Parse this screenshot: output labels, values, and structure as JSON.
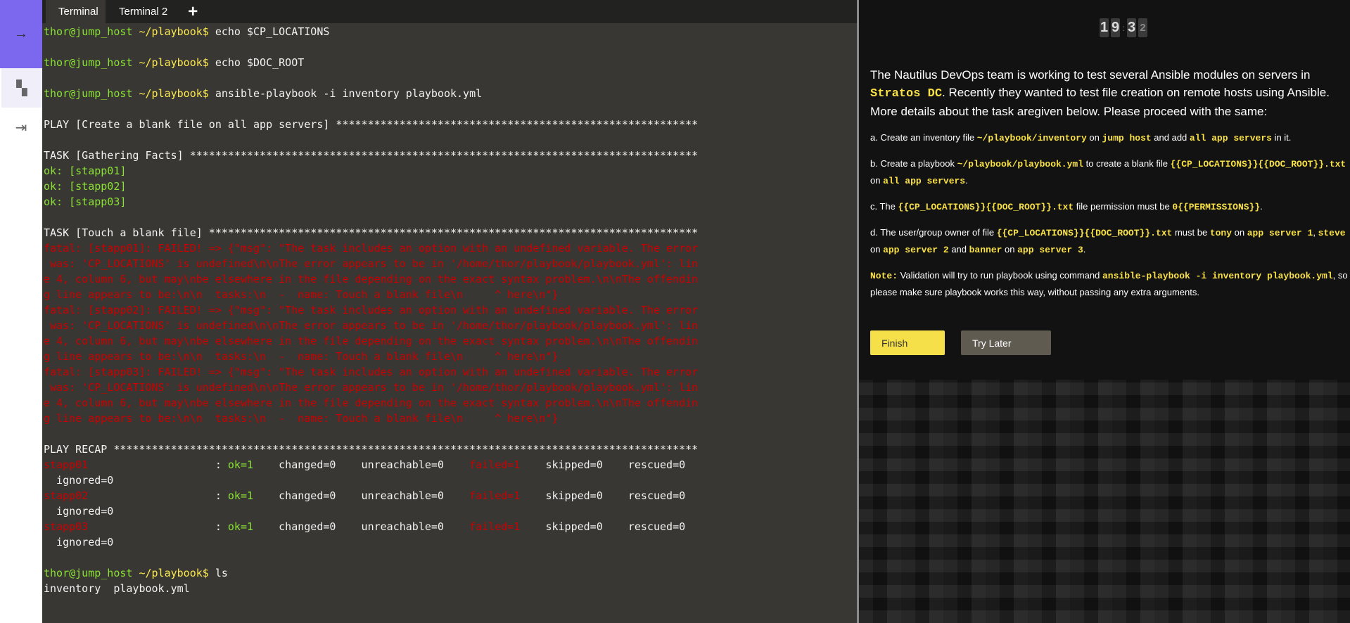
{
  "sidebar": {
    "items": [
      {
        "icon": "arrow-right-icon",
        "glyph": "→"
      },
      {
        "icon": "dashboard-icon",
        "glyph": "▚"
      },
      {
        "icon": "exit-icon",
        "glyph": "⇥"
      }
    ]
  },
  "tabs": [
    {
      "label": "Terminal"
    },
    {
      "label": "Terminal 2"
    }
  ],
  "add_tab_glyph": "+",
  "terminal": {
    "lines": [
      [
        [
          "g",
          "thor@jump_host "
        ],
        [
          "y",
          "~/playbook$ "
        ],
        [
          "w",
          "echo $CP_LOCATIONS"
        ]
      ],
      [],
      [
        [
          "g",
          "thor@jump_host "
        ],
        [
          "y",
          "~/playbook$ "
        ],
        [
          "w",
          "echo $DOC_ROOT"
        ]
      ],
      [],
      [
        [
          "g",
          "thor@jump_host "
        ],
        [
          "y",
          "~/playbook$ "
        ],
        [
          "w",
          "ansible-playbook -i inventory playbook.yml"
        ]
      ],
      [],
      [
        [
          "w",
          "PLAY [Create a blank file on all app servers] *********************************************************"
        ]
      ],
      [],
      [
        [
          "w",
          "TASK [Gathering Facts] ********************************************************************************"
        ]
      ],
      [
        [
          "g",
          "ok: [stapp01]"
        ]
      ],
      [
        [
          "g",
          "ok: [stapp02]"
        ]
      ],
      [
        [
          "g",
          "ok: [stapp03]"
        ]
      ],
      [],
      [
        [
          "w",
          "TASK [Touch a blank file] *****************************************************************************"
        ]
      ],
      [
        [
          "r",
          "fatal: [stapp01]: FAILED! => {\"msg\": \"The task includes an option with an undefined variable. The error"
        ]
      ],
      [
        [
          "r",
          " was: 'CP_LOCATIONS' is undefined\\n\\nThe error appears to be in '/home/thor/playbook/playbook.yml': lin"
        ]
      ],
      [
        [
          "r",
          "e 4, column 6, but may\\nbe elsewhere in the file depending on the exact syntax problem.\\n\\nThe offendin"
        ]
      ],
      [
        [
          "r",
          "g line appears to be:\\n\\n  tasks:\\n  -  name: Touch a blank file\\n     ^ here\\n\"}"
        ]
      ],
      [
        [
          "r",
          "fatal: [stapp02]: FAILED! => {\"msg\": \"The task includes an option with an undefined variable. The error"
        ]
      ],
      [
        [
          "r",
          " was: 'CP_LOCATIONS' is undefined\\n\\nThe error appears to be in '/home/thor/playbook/playbook.yml': lin"
        ]
      ],
      [
        [
          "r",
          "e 4, column 6, but may\\nbe elsewhere in the file depending on the exact syntax problem.\\n\\nThe offendin"
        ]
      ],
      [
        [
          "r",
          "g line appears to be:\\n\\n  tasks:\\n  -  name: Touch a blank file\\n     ^ here\\n\"}"
        ]
      ],
      [
        [
          "r",
          "fatal: [stapp03]: FAILED! => {\"msg\": \"The task includes an option with an undefined variable. The error"
        ]
      ],
      [
        [
          "r",
          " was: 'CP_LOCATIONS' is undefined\\n\\nThe error appears to be in '/home/thor/playbook/playbook.yml': lin"
        ]
      ],
      [
        [
          "r",
          "e 4, column 6, but may\\nbe elsewhere in the file depending on the exact syntax problem.\\n\\nThe offendin"
        ]
      ],
      [
        [
          "r",
          "g line appears to be:\\n\\n  tasks:\\n  -  name: Touch a blank file\\n     ^ here\\n\"}"
        ]
      ],
      [],
      [
        [
          "w",
          "PLAY RECAP ********************************************************************************************"
        ]
      ],
      [
        [
          "r",
          "stapp01"
        ],
        [
          "w",
          "                    : "
        ],
        [
          "g",
          "ok=1"
        ],
        [
          "w",
          "    changed=0    unreachable=0    "
        ],
        [
          "r",
          "failed=1"
        ],
        [
          "w",
          "    skipped=0    rescued=0"
        ]
      ],
      [
        [
          "w",
          "  ignored=0"
        ]
      ],
      [
        [
          "r",
          "stapp02"
        ],
        [
          "w",
          "                    : "
        ],
        [
          "g",
          "ok=1"
        ],
        [
          "w",
          "    changed=0    unreachable=0    "
        ],
        [
          "r",
          "failed=1"
        ],
        [
          "w",
          "    skipped=0    rescued=0"
        ]
      ],
      [
        [
          "w",
          "  ignored=0"
        ]
      ],
      [
        [
          "r",
          "stapp03"
        ],
        [
          "w",
          "                    : "
        ],
        [
          "g",
          "ok=1"
        ],
        [
          "w",
          "    changed=0    unreachable=0    "
        ],
        [
          "r",
          "failed=1"
        ],
        [
          "w",
          "    skipped=0    rescued=0"
        ]
      ],
      [
        [
          "w",
          "  ignored=0"
        ]
      ],
      [],
      [
        [
          "g",
          "thor@jump_host "
        ],
        [
          "y",
          "~/playbook$ "
        ],
        [
          "w",
          "ls"
        ]
      ],
      [
        [
          "w",
          "inventory  playbook.yml"
        ]
      ]
    ]
  },
  "timer": {
    "digits": [
      "1",
      "9",
      "3",
      "2"
    ]
  },
  "task": {
    "intro": [
      [
        "t",
        "The Nautilus DevOps team is working to test several Ansible modules on servers in "
      ],
      [
        "c",
        "Stratos DC"
      ],
      [
        "t",
        ". Recently they wanted to test file creation on remote hosts using Ansible. More details about the task aregiven below. Please proceed with the same:"
      ]
    ],
    "paragraphs": [
      [
        [
          "t",
          "a. Create an inventory file "
        ],
        [
          "c",
          "~/playbook/inventory"
        ],
        [
          "t",
          " on "
        ],
        [
          "c",
          "jump host"
        ],
        [
          "t",
          " and add "
        ],
        [
          "c",
          "all app servers"
        ],
        [
          "t",
          " in it."
        ]
      ],
      [
        [
          "t",
          "b. Create a playbook "
        ],
        [
          "c",
          "~/playbook/playbook.yml"
        ],
        [
          "t",
          " to create a blank file "
        ],
        [
          "c",
          "{{CP_LOCATIONS}}{{DOC_ROOT}}.txt"
        ],
        [
          "t",
          " on "
        ],
        [
          "c",
          "all app servers"
        ],
        [
          "t",
          "."
        ]
      ],
      [
        [
          "t",
          "c. The "
        ],
        [
          "c",
          "{{CP_LOCATIONS}}{{DOC_ROOT}}.txt"
        ],
        [
          "t",
          " file permission must be "
        ],
        [
          "c",
          "0{{PERMISSIONS}}"
        ],
        [
          "t",
          "."
        ]
      ],
      [
        [
          "t",
          "d. The user/group owner of file "
        ],
        [
          "c",
          "{{CP_LOCATIONS}}{{DOC_ROOT}}.txt"
        ],
        [
          "t",
          " must be "
        ],
        [
          "c",
          "tony"
        ],
        [
          "t",
          " on "
        ],
        [
          "c",
          "app server 1"
        ],
        [
          "t",
          ", "
        ],
        [
          "c",
          "steve"
        ],
        [
          "t",
          " on "
        ],
        [
          "c",
          "app server 2"
        ],
        [
          "t",
          " and "
        ],
        [
          "c",
          "banner"
        ],
        [
          "t",
          " on "
        ],
        [
          "c",
          "app server 3"
        ],
        [
          "t",
          "."
        ]
      ],
      [
        [
          "c",
          "Note:"
        ],
        [
          "t",
          " Validation will try to run playbook using command "
        ],
        [
          "c",
          "ansible-playbook -i inventory playbook.yml"
        ],
        [
          "t",
          ", so please make sure playbook works this way, without passing any extra arguments."
        ]
      ]
    ]
  },
  "buttons": {
    "finish": "Finish",
    "try_later": "Try Later"
  }
}
